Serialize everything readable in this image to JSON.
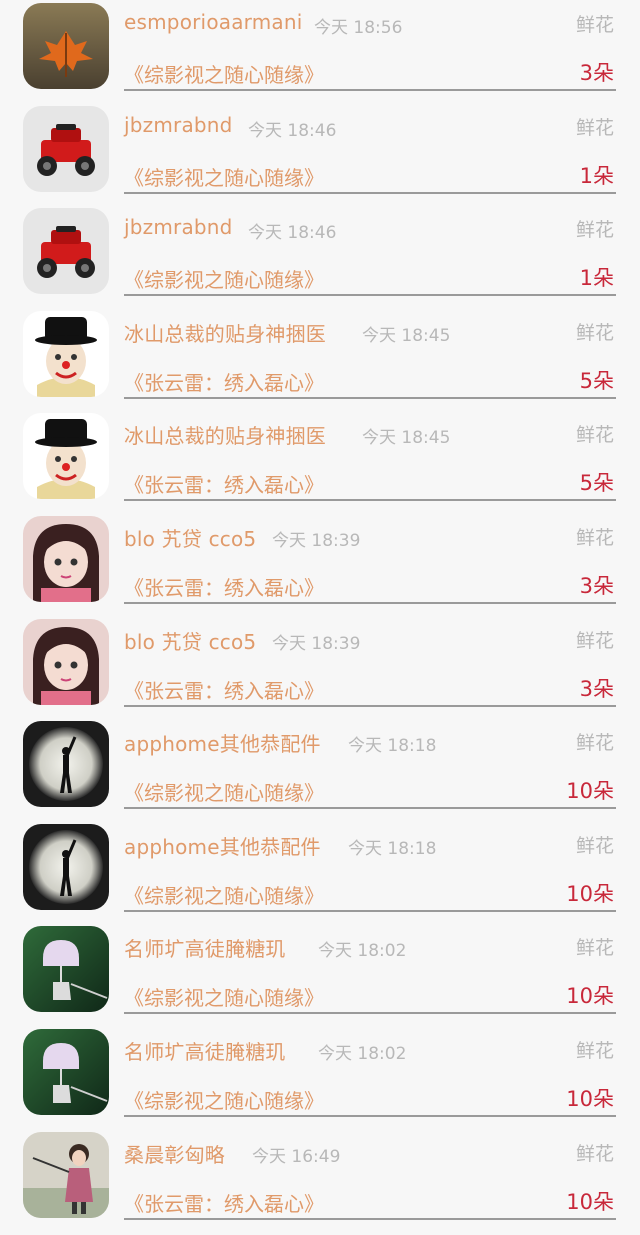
{
  "rows": [
    {
      "name": "esmporioaarmani",
      "time": "今天 18:56",
      "gift": "鲜花",
      "book": "《综影视之随心随缘》",
      "count": "3朵",
      "avatar": "leaf"
    },
    {
      "name": "jbzmrabnd",
      "time": "今天 18:46",
      "gift": "鲜花",
      "book": "《综影视之随心随缘》",
      "count": "1朵",
      "avatar": "car"
    },
    {
      "name": "jbzmrabnd",
      "time": "今天 18:46",
      "gift": "鲜花",
      "book": "《综影视之随心随缘》",
      "count": "1朵",
      "avatar": "car"
    },
    {
      "name": "冰山总裁的贴身神捆医",
      "time": "今天 18:45",
      "gift": "鲜花",
      "book": "《张云雷：绣入磊心》",
      "count": "5朵",
      "avatar": "clown"
    },
    {
      "name": "冰山总裁的贴身神捆医",
      "time": "今天 18:45",
      "gift": "鲜花",
      "book": "《张云雷：绣入磊心》",
      "count": "5朵",
      "avatar": "clown"
    },
    {
      "name": "blo 艽贷 cco5",
      "time": "今天 18:39",
      "gift": "鲜花",
      "book": "《张云雷：绣入磊心》",
      "count": "3朵",
      "avatar": "girl"
    },
    {
      "name": "blo 艽贷 cco5",
      "time": "今天 18:39",
      "gift": "鲜花",
      "book": "《张云雷：绣入磊心》",
      "count": "3朵",
      "avatar": "girl"
    },
    {
      "name": "apphome其他恭配件",
      "time": "今天 18:18",
      "gift": "鲜花",
      "book": "《综影视之随心随缘》",
      "count": "10朵",
      "avatar": "spotlight"
    },
    {
      "name": "apphome其他恭配件",
      "time": "今天 18:18",
      "gift": "鲜花",
      "book": "《综影视之随心随缘》",
      "count": "10朵",
      "avatar": "spotlight"
    },
    {
      "name": "名师圹高徒腌糖玑",
      "time": "今天 18:02",
      "gift": "鲜花",
      "book": "《综影视之随心随缘》",
      "count": "10朵",
      "avatar": "bell"
    },
    {
      "name": "名师圹高徒腌糖玑",
      "time": "今天 18:02",
      "gift": "鲜花",
      "book": "《综影视之随心随缘》",
      "count": "10朵",
      "avatar": "bell"
    },
    {
      "name": "桑晨彰匈略",
      "time": "今天 16:49",
      "gift": "鲜花",
      "book": "《张云雷：绣入磊心》",
      "count": "10朵",
      "avatar": "child"
    }
  ]
}
